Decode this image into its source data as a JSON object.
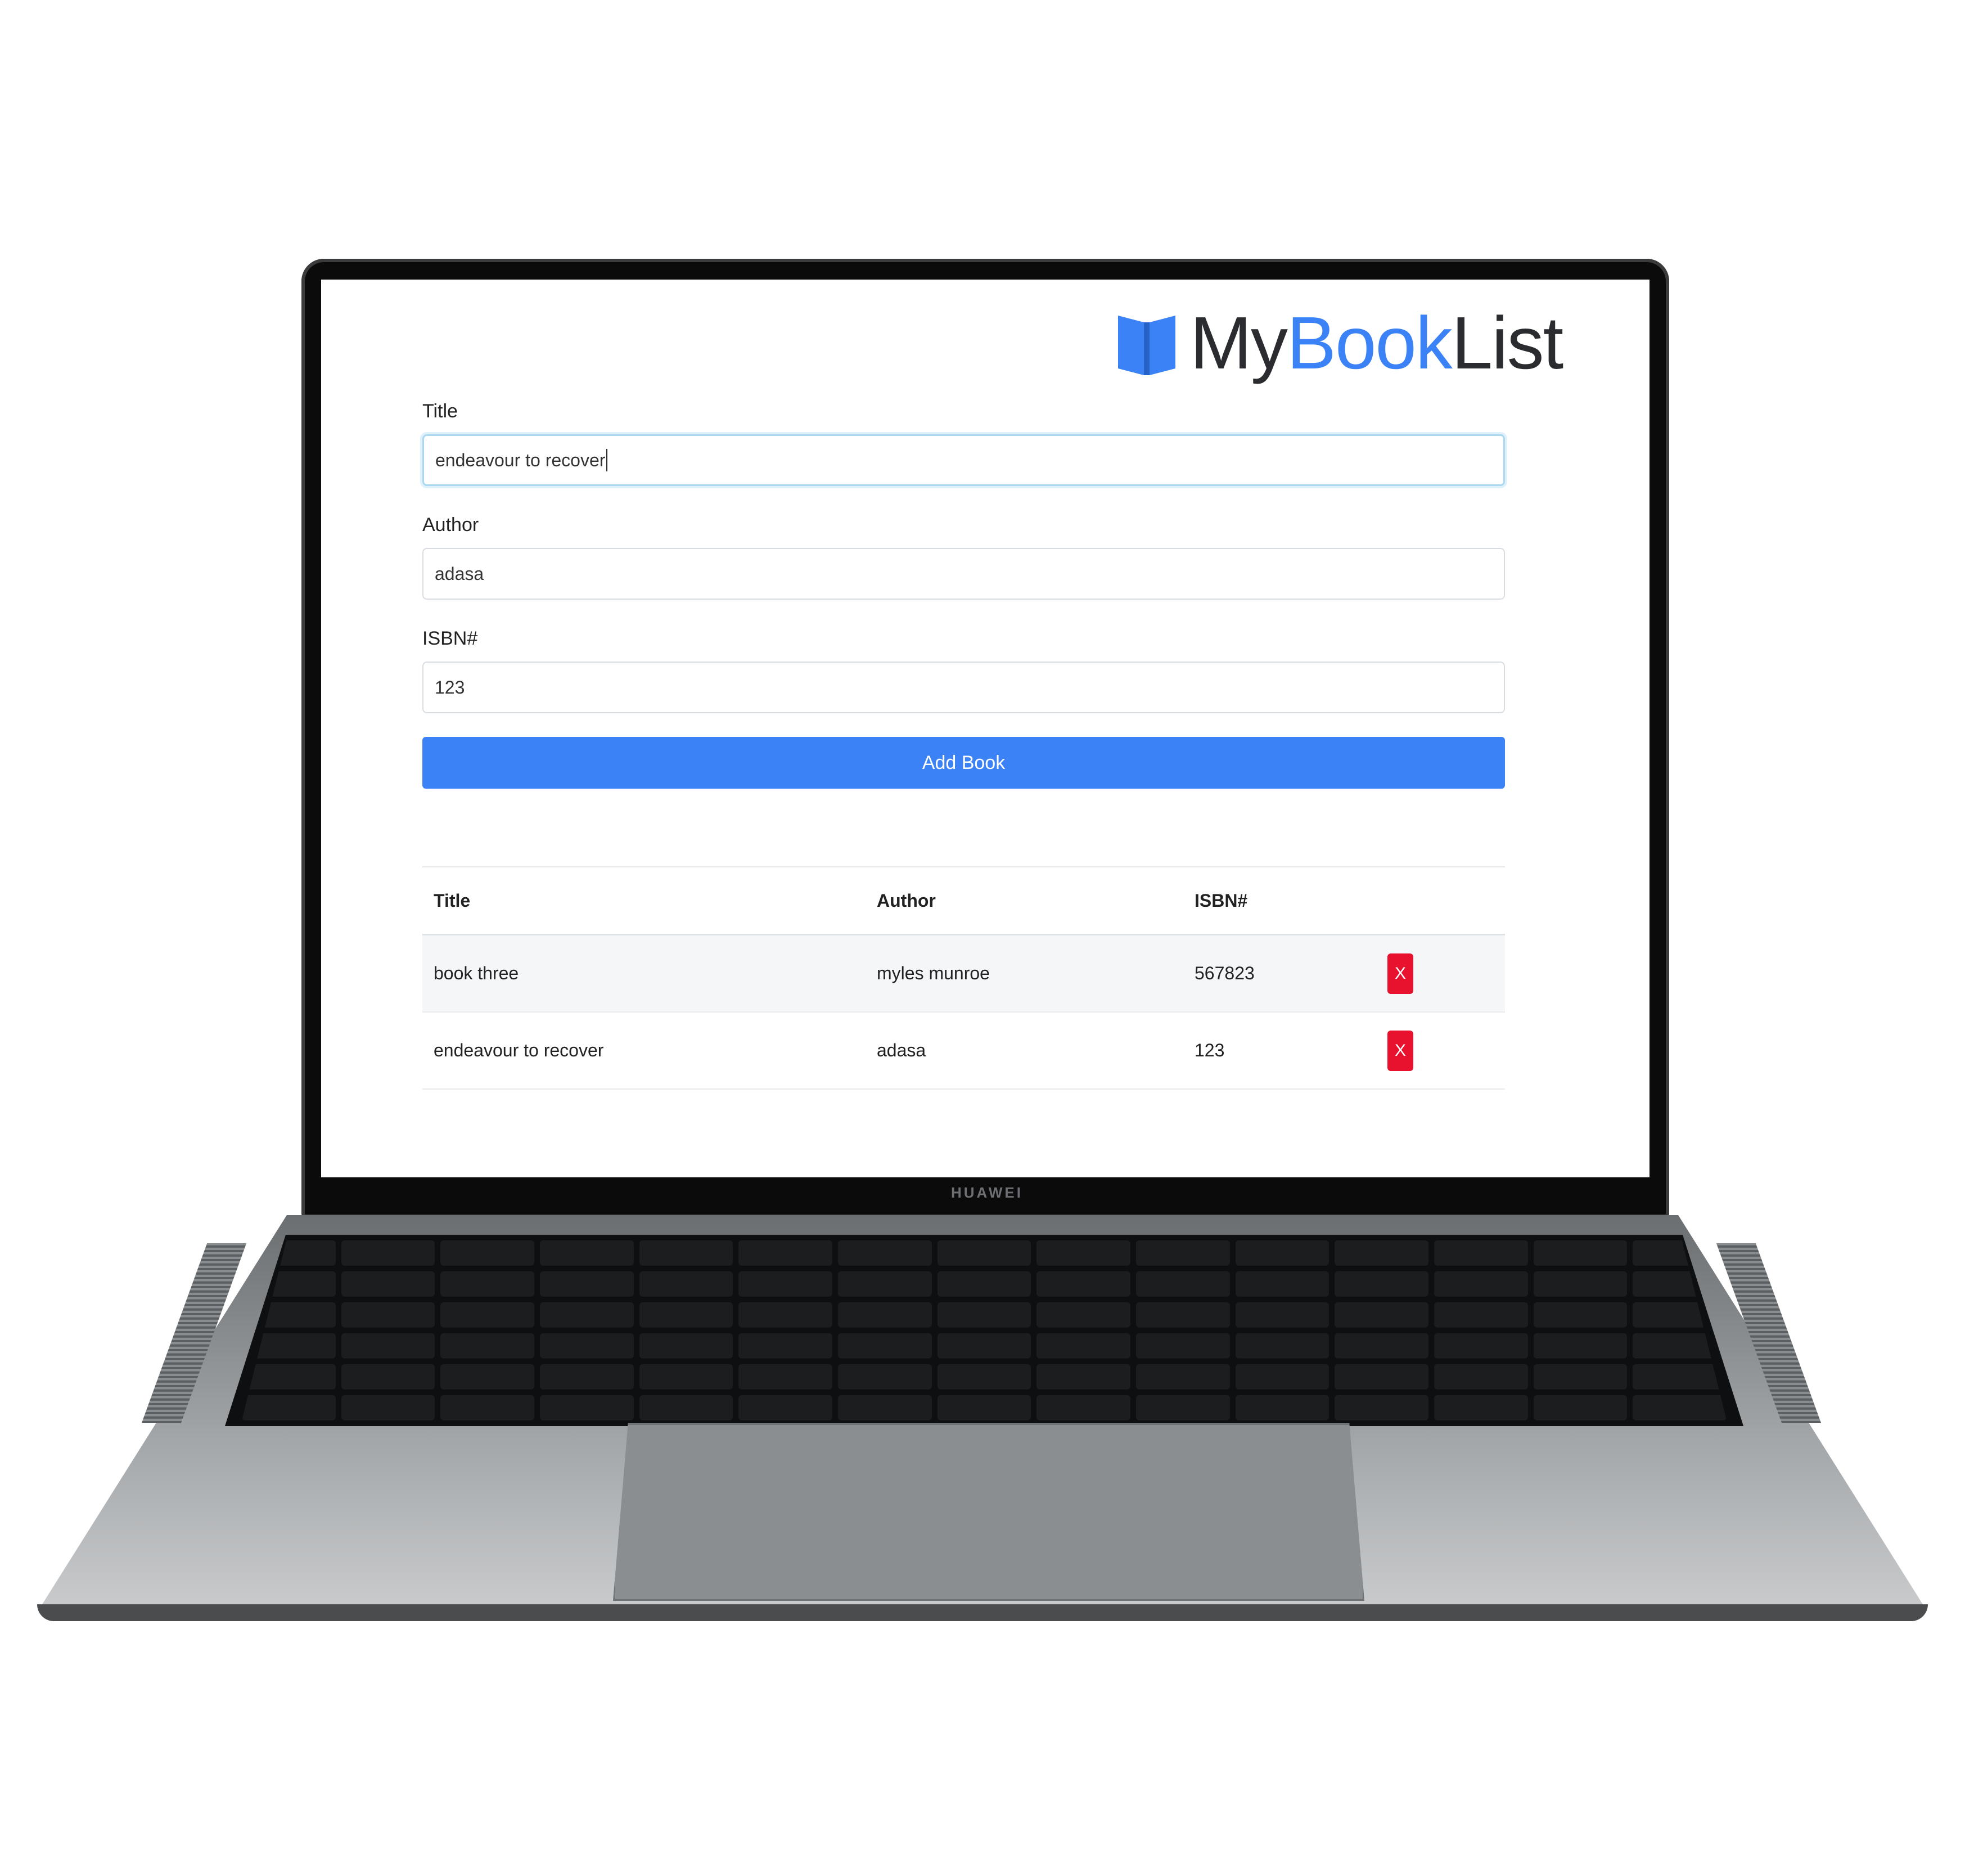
{
  "app": {
    "logo_prefix": "My",
    "logo_accent": "Book",
    "logo_suffix": "List",
    "brand_color": "#3b82f6"
  },
  "form": {
    "title_label": "Title",
    "title_value": "endeavour to recover",
    "author_label": "Author",
    "author_value": "adasa",
    "isbn_label": "ISBN#",
    "isbn_value": "123",
    "submit_label": "Add Book"
  },
  "table": {
    "headers": [
      "Title",
      "Author",
      "ISBN#"
    ],
    "rows": [
      {
        "title": "book three",
        "author": "myles munroe",
        "isbn": "567823",
        "delete_label": "X"
      },
      {
        "title": "endeavour to recover",
        "author": "adasa",
        "isbn": "123",
        "delete_label": "X"
      }
    ],
    "delete_color": "#e8122f"
  },
  "device": {
    "brand": "HUAWEI"
  }
}
